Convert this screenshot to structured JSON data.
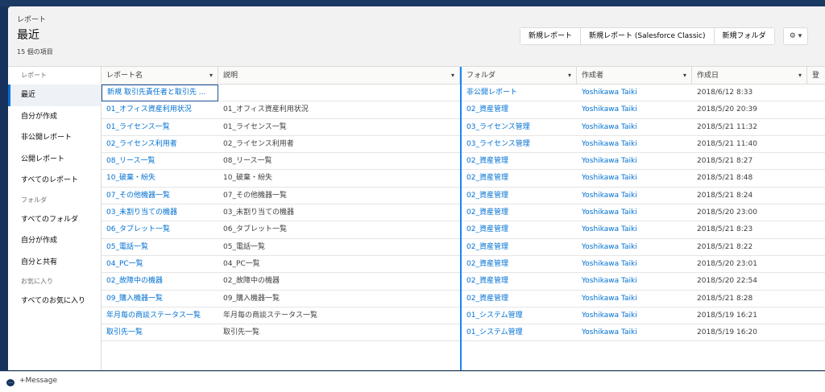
{
  "header": {
    "object_label": "レポート",
    "title": "最近",
    "item_count": "15 個の項目",
    "buttons": [
      "新規レポート",
      "新規レポート (Salesforce Classic)",
      "新規フォルダ"
    ],
    "gear_glyph": "⚙ ▾"
  },
  "sidebar": {
    "sections": [
      {
        "label": "レポート",
        "items": [
          "最近",
          "自分が作成",
          "非公開レポート",
          "公開レポート",
          "すべてのレポート"
        ]
      },
      {
        "label": "フォルダ",
        "items": [
          "すべてのフォルダ",
          "自分が作成",
          "自分と共有"
        ]
      },
      {
        "label": "お気に入り",
        "items": [
          "すべてのお気に入り"
        ]
      }
    ],
    "active": "最近"
  },
  "table": {
    "columns": [
      "レポート名",
      "説明",
      "フォルダ",
      "作成者",
      "作成日",
      "登"
    ],
    "rows": [
      [
        "新規 取引先責任者と取引先 ...",
        "",
        "非公開レポート",
        "Yoshikawa Taiki",
        "2018/6/12 8:33"
      ],
      [
        "01_オフィス資産利用状況",
        "01_オフィス資産利用状況",
        "02_資産管理",
        "Yoshikawa Taiki",
        "2018/5/20 20:39"
      ],
      [
        "01_ライセンス一覧",
        "01_ライセンス一覧",
        "03_ライセンス管理",
        "Yoshikawa Taiki",
        "2018/5/21 11:32"
      ],
      [
        "02_ライセンス利用者",
        "02_ライセンス利用者",
        "03_ライセンス管理",
        "Yoshikawa Taiki",
        "2018/5/21 11:40"
      ],
      [
        "08_リース一覧",
        "08_リース一覧",
        "02_資産管理",
        "Yoshikawa Taiki",
        "2018/5/21 8:27"
      ],
      [
        "10_破棄・紛失",
        "10_破棄・紛失",
        "02_資産管理",
        "Yoshikawa Taiki",
        "2018/5/21 8:48"
      ],
      [
        "07_その他機器一覧",
        "07_その他機器一覧",
        "02_資産管理",
        "Yoshikawa Taiki",
        "2018/5/21 8:24"
      ],
      [
        "03_未割り当ての機器",
        "03_未割り当ての機器",
        "02_資産管理",
        "Yoshikawa Taiki",
        "2018/5/20 23:00"
      ],
      [
        "06_タブレット一覧",
        "06_タブレット一覧",
        "02_資産管理",
        "Yoshikawa Taiki",
        "2018/5/21 8:23"
      ],
      [
        "05_電話一覧",
        "05_電話一覧",
        "02_資産管理",
        "Yoshikawa Taiki",
        "2018/5/21 8:22"
      ],
      [
        "04_PC一覧",
        "04_PC一覧",
        "02_資産管理",
        "Yoshikawa Taiki",
        "2018/5/20 23:01"
      ],
      [
        "02_故障中の機器",
        "02_故障中の機器",
        "02_資産管理",
        "Yoshikawa Taiki",
        "2018/5/20 22:54"
      ],
      [
        "09_購入機器一覧",
        "09_購入機器一覧",
        "02_資産管理",
        "Yoshikawa Taiki",
        "2018/5/21 8:28"
      ],
      [
        "年月毎の商談ステータス一覧",
        "年月毎の商談ステータス一覧",
        "01_システム管理",
        "Yoshikawa Taiki",
        "2018/5/19 16:21"
      ],
      [
        "取引先一覧",
        "取引先一覧",
        "01_システム管理",
        "Yoshikawa Taiki",
        "2018/5/19 16:20"
      ]
    ]
  },
  "footer": {
    "message_label": "+Message"
  }
}
